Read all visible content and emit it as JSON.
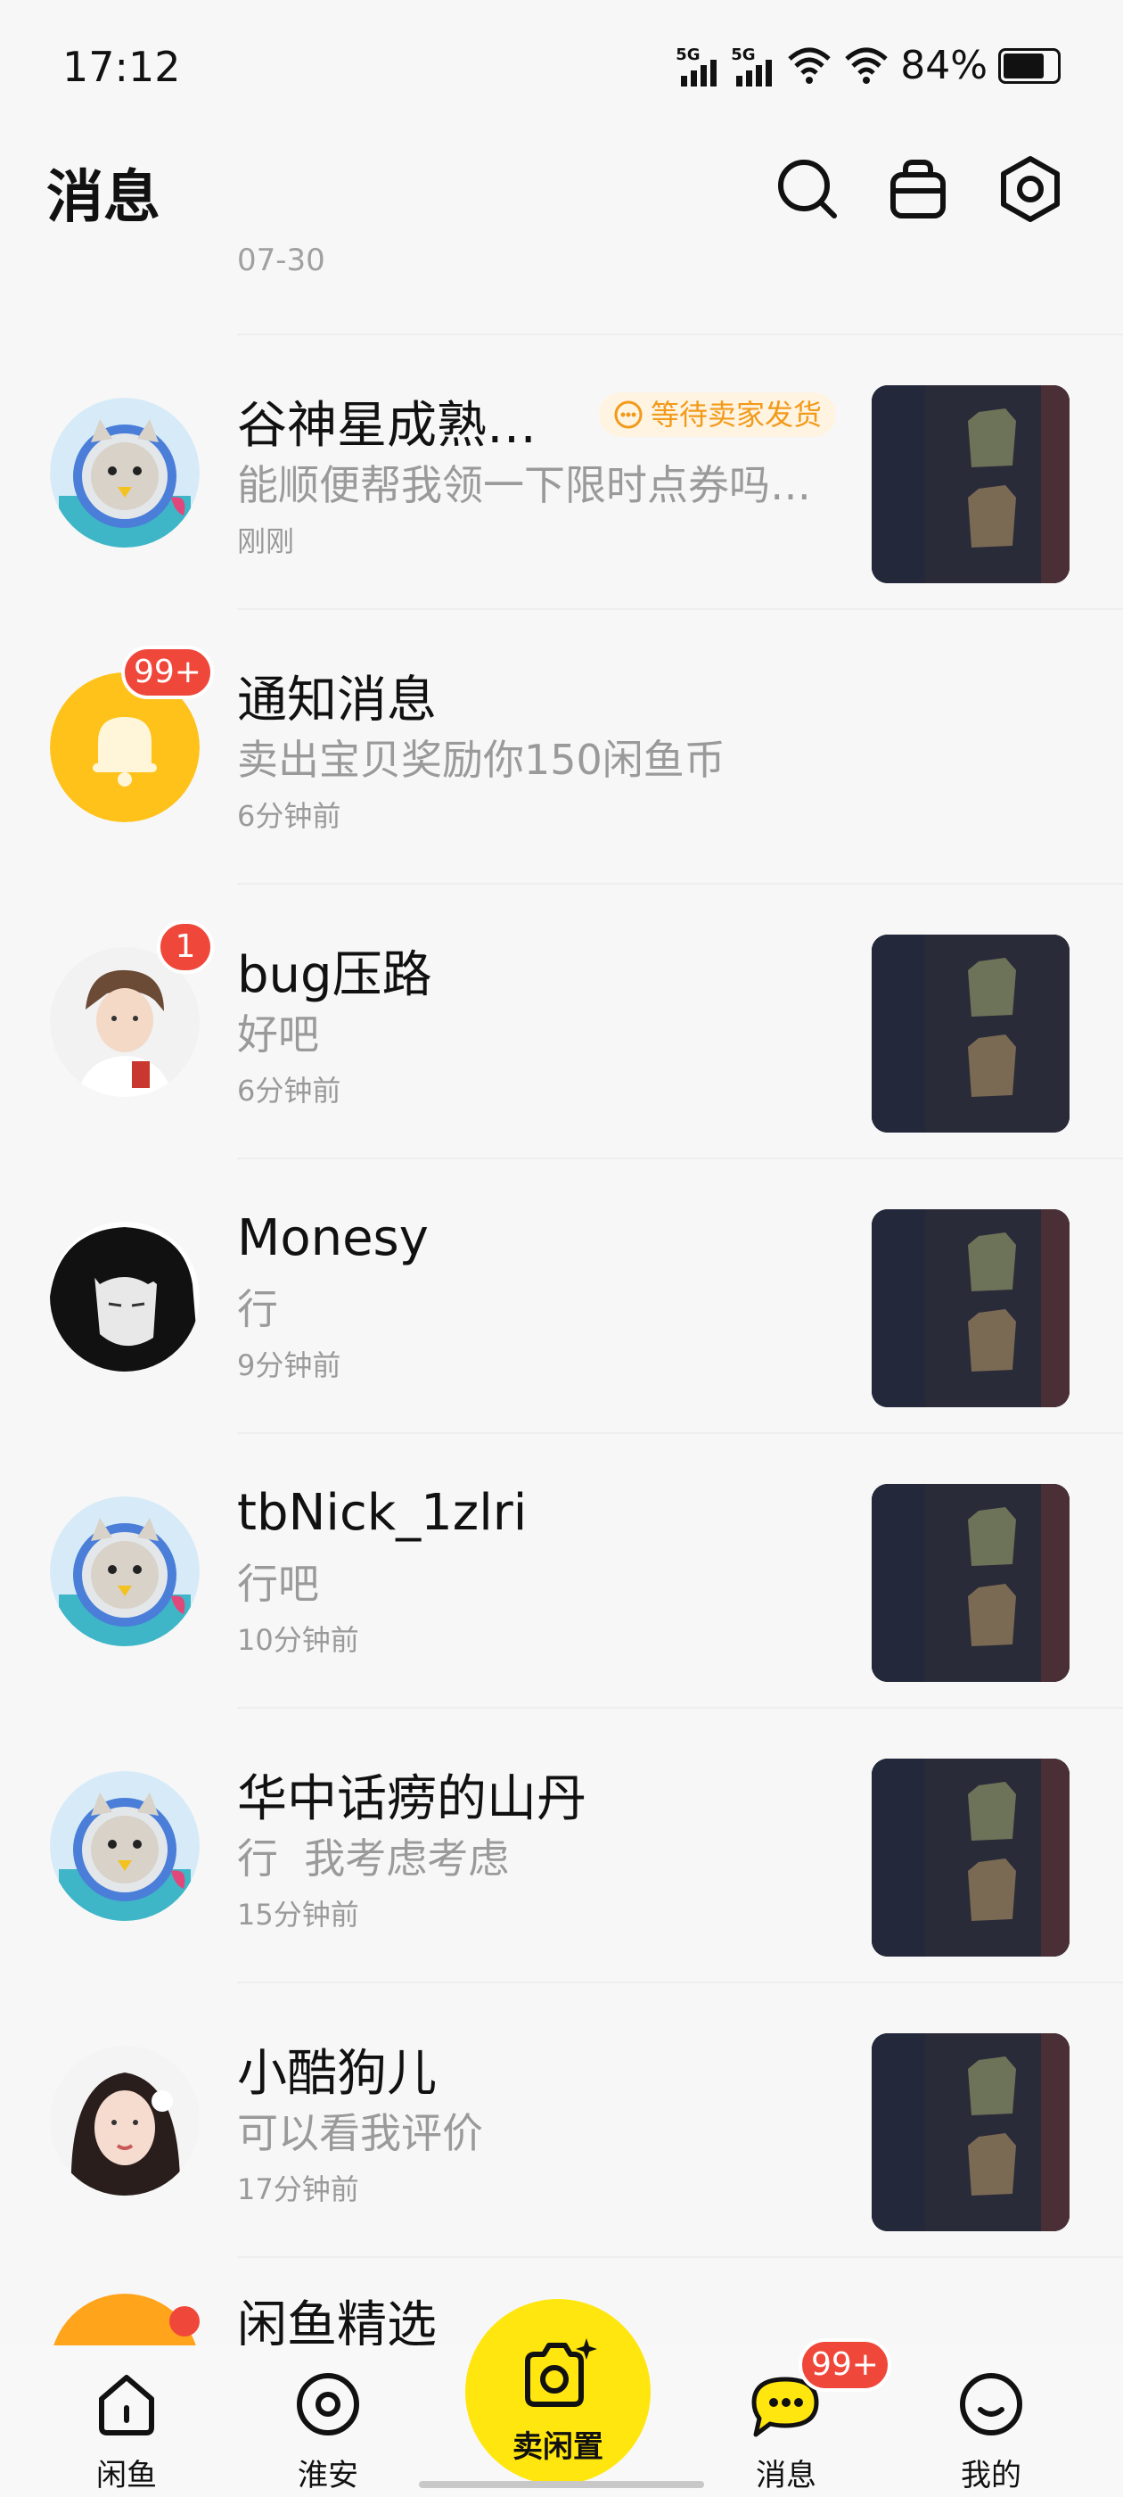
{
  "status": {
    "time": "17:12",
    "signal1": "5G",
    "signal2": "5G",
    "battery": "84%"
  },
  "header": {
    "title": "消息"
  },
  "previous_item_time": "07-30",
  "conversations": [
    {
      "name": "谷神星成熟…",
      "tag": "等待卖家发货",
      "message": "能顺便帮我领一下限时点券吗…",
      "time": "刚刚"
    },
    {
      "name": "通知消息",
      "badge": "99+",
      "message": "卖出宝贝奖励你150闲鱼币",
      "time": "6分钟前"
    },
    {
      "name": "bug压路",
      "badge": "1",
      "message": "好吧",
      "time": "6分钟前"
    },
    {
      "name": "Monesy",
      "message": "行",
      "time": "9分钟前"
    },
    {
      "name": "tbNick_1zlri",
      "message": "行吧",
      "time": "10分钟前"
    },
    {
      "name": "华中话痨的山丹",
      "message": "行  我考虑考虑",
      "time": "15分钟前"
    },
    {
      "name": "小酷狗儿",
      "message": "可以看我评价",
      "time": "17分钟前"
    },
    {
      "name": "闲鱼精选"
    }
  ],
  "tabbar": {
    "tab1": "闲鱼",
    "tab2": "淮安",
    "sell": "卖闲置",
    "tab3": "消息",
    "tab3_badge": "99+",
    "tab4": "我的"
  },
  "colors": {
    "accent_yellow": "#ffe60f",
    "badge_red": "#f0473b",
    "tag_orange": "#f29a1a"
  }
}
